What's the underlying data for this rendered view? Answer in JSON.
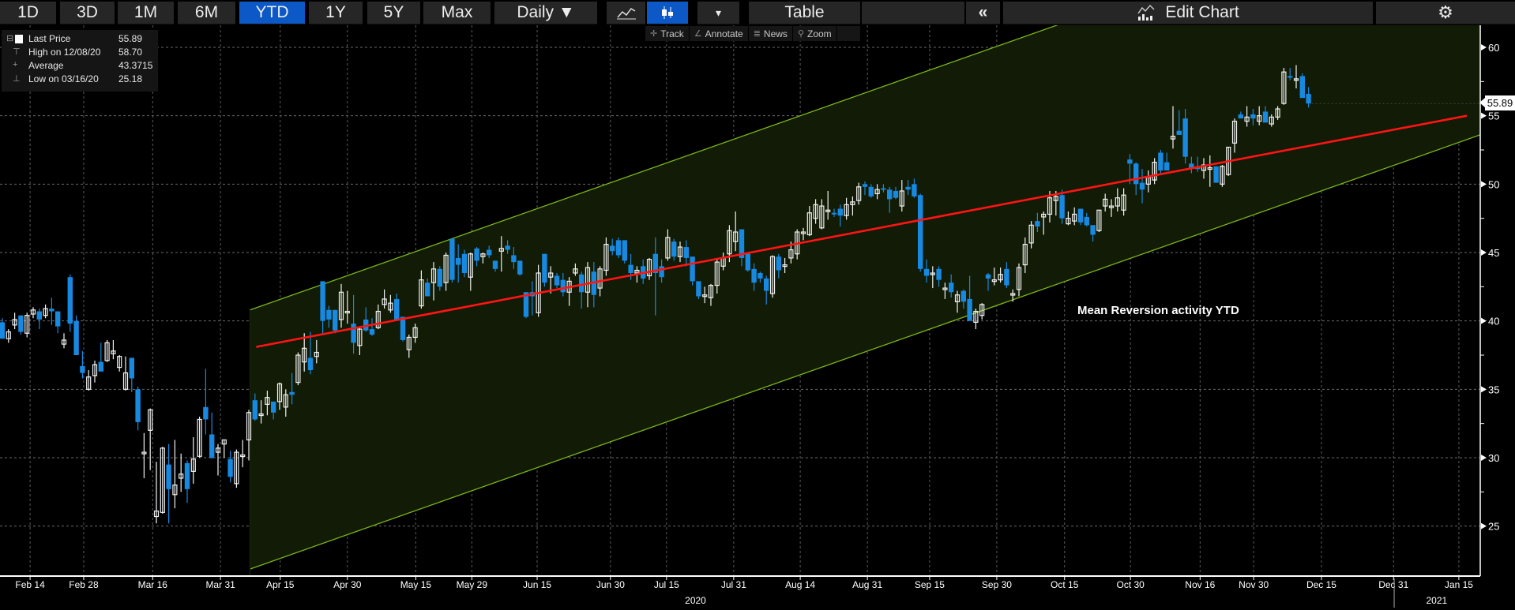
{
  "toolbar": {
    "ranges": [
      "1D",
      "3D",
      "1M",
      "6M",
      "YTD",
      "1Y",
      "5Y",
      "Max"
    ],
    "active_range": "YTD",
    "frequency": "Daily ▼",
    "line_icon": "line-chart-icon",
    "candle_icon": "candlestick-icon",
    "dropdown": "▾",
    "table": "Table",
    "collapse": "«",
    "edit_chart": "Edit Chart",
    "settings_icon": "gear-icon"
  },
  "subbar": {
    "track": "Track",
    "annotate": "Annotate",
    "news": "News",
    "zoom": "Zoom"
  },
  "legend": [
    {
      "label": "Last Price",
      "value": "55.89"
    },
    {
      "label": "High on 12/08/20",
      "value": "58.70"
    },
    {
      "label": "Average",
      "value": "43.3715"
    },
    {
      "label": "Low on 03/16/20",
      "value": "25.18"
    }
  ],
  "annotation": "Mean Reversion activity YTD",
  "last_price_tag": "55.89",
  "colors": {
    "up": "#f2f2f2",
    "down": "#1789e0",
    "regression": "#ff1414",
    "channel_line": "#7cb518",
    "channel_fill": "#121b05",
    "active": "#0b58c6"
  },
  "chart_data": {
    "type": "candlestick",
    "title": "",
    "ylim": [
      22,
      62
    ],
    "yticks": [
      25,
      30,
      35,
      40,
      45,
      50,
      55,
      60
    ],
    "ytick_labels": [
      "25",
      "30",
      "35",
      "40",
      "45",
      "50",
      "55",
      "60"
    ],
    "x_unit": "trading-day index",
    "xticks": [
      {
        "label": "Feb 14",
        "x": 4.5
      },
      {
        "label": "Feb 28",
        "x": 13.2
      },
      {
        "label": "Mar 16",
        "x": 24.4
      },
      {
        "label": "Mar 31",
        "x": 35.4
      },
      {
        "label": "Apr 15",
        "x": 45.1
      },
      {
        "label": "Apr 30",
        "x": 56.0
      },
      {
        "label": "May 15",
        "x": 67.1
      },
      {
        "label": "May 29",
        "x": 76.2
      },
      {
        "label": "Jun 15",
        "x": 86.8
      },
      {
        "label": "Jun 30",
        "x": 98.7
      },
      {
        "label": "Jul 15",
        "x": 107.8
      },
      {
        "label": "Jul 31",
        "x": 118.7
      },
      {
        "label": "Aug 14",
        "x": 129.5
      },
      {
        "label": "Aug 31",
        "x": 140.4
      },
      {
        "label": "Sep 15",
        "x": 150.5
      },
      {
        "label": "Sep 30",
        "x": 161.4
      },
      {
        "label": "Oct 15",
        "x": 172.4
      },
      {
        "label": "Oct 30",
        "x": 183.1
      },
      {
        "label": "Nov 16",
        "x": 194.4
      },
      {
        "label": "Nov 30",
        "x": 203.1
      },
      {
        "label": "Dec 15",
        "x": 214.1
      },
      {
        "label": "Dec 31",
        "x": 225.8
      },
      {
        "label": "Jan 15",
        "x": 236.4
      }
    ],
    "years": [
      {
        "label": "2020",
        "x": 112.5
      },
      {
        "label": "2021",
        "x": 232.8
      }
    ],
    "year_divider_x": 225.9,
    "regression": {
      "x0": 41.2,
      "y0": 38.1,
      "x1": 237.7,
      "y1": 55.0
    },
    "channel": {
      "x0": 40.2,
      "x1": 239.9,
      "upper": [
        40.8,
        72.55
      ],
      "lower": [
        21.86,
        53.61
      ]
    },
    "last_price": 55.89,
    "candles_format": [
      "open",
      "high",
      "low",
      "close"
    ],
    "candles": [
      [
        39.9,
        40.2,
        38.7,
        38.7
      ],
      [
        38.7,
        39.4,
        38.4,
        39.2
      ],
      [
        39.7,
        40.6,
        39.4,
        40.1
      ],
      [
        40.4,
        40.4,
        39.0,
        39.2
      ],
      [
        39.1,
        40.6,
        38.8,
        40.4
      ],
      [
        40.5,
        41.0,
        40.2,
        40.8
      ],
      [
        40.7,
        40.9,
        39.4,
        40.1
      ],
      [
        40.4,
        41.2,
        40.2,
        40.9
      ],
      [
        40.9,
        41.7,
        39.7,
        40.7
      ],
      [
        40.7,
        40.7,
        39.1,
        39.6
      ],
      [
        38.3,
        39.1,
        38.0,
        38.6
      ],
      [
        43.2,
        43.4,
        39.2,
        39.8
      ],
      [
        40.0,
        40.4,
        37.5,
        37.5
      ],
      [
        36.7,
        37.8,
        35.8,
        36.2
      ],
      [
        35.0,
        36.4,
        34.9,
        35.9
      ],
      [
        36.0,
        37.1,
        35.5,
        36.8
      ],
      [
        37.0,
        38.4,
        36.3,
        36.3
      ],
      [
        37.1,
        38.6,
        37.0,
        38.4
      ],
      [
        37.6,
        38.6,
        37.2,
        37.8
      ],
      [
        36.6,
        37.5,
        36.3,
        37.4
      ],
      [
        35.0,
        37.4,
        34.9,
        36.2
      ],
      [
        37.3,
        37.3,
        34.8,
        35.8
      ],
      [
        35.0,
        35.2,
        32.0,
        32.6
      ],
      [
        30.4,
        31.8,
        28.5,
        30.4
      ],
      [
        32.0,
        33.6,
        29.1,
        33.5
      ],
      [
        25.7,
        29.7,
        25.2,
        26.1
      ],
      [
        26.0,
        30.8,
        25.9,
        30.7
      ],
      [
        29.5,
        31.0,
        25.2,
        27.7
      ],
      [
        27.3,
        31.3,
        26.3,
        28.0
      ],
      [
        28.5,
        30.3,
        27.5,
        28.8
      ],
      [
        29.6,
        29.8,
        26.7,
        27.7
      ],
      [
        29.0,
        31.5,
        28.1,
        29.9
      ],
      [
        30.1,
        33.0,
        30.0,
        32.8
      ],
      [
        33.7,
        36.5,
        31.7,
        32.8
      ],
      [
        31.7,
        33.3,
        29.9,
        30.0
      ],
      [
        30.4,
        31.0,
        28.7,
        30.7
      ],
      [
        31.0,
        31.3,
        30.0,
        31.3
      ],
      [
        29.9,
        30.5,
        28.2,
        28.6
      ],
      [
        28.1,
        30.6,
        27.8,
        30.4
      ],
      [
        30.2,
        31.3,
        29.3,
        30.2
      ],
      [
        31.3,
        33.5,
        29.8,
        33.3
      ],
      [
        34.2,
        34.7,
        32.7,
        32.8
      ],
      [
        33.2,
        34.2,
        32.5,
        33.2
      ],
      [
        33.9,
        34.9,
        33.1,
        34.4
      ],
      [
        34.1,
        34.1,
        32.8,
        33.3
      ],
      [
        34.1,
        35.5,
        33.5,
        35.4
      ],
      [
        33.7,
        35.0,
        33.0,
        34.6
      ],
      [
        34.8,
        36.2,
        33.9,
        34.6
      ],
      [
        35.5,
        37.7,
        35.3,
        37.5
      ],
      [
        37.0,
        39.1,
        36.3,
        38.0
      ],
      [
        37.3,
        39.2,
        36.1,
        36.4
      ],
      [
        37.4,
        38.6,
        36.9,
        37.7
      ],
      [
        42.9,
        42.9,
        39.0,
        40.0
      ],
      [
        40.8,
        41.1,
        39.5,
        40.1
      ],
      [
        40.8,
        40.8,
        39.1,
        39.3
      ],
      [
        40.1,
        42.7,
        39.5,
        42.1
      ],
      [
        40.7,
        42.2,
        39.8,
        40.7
      ],
      [
        39.8,
        41.9,
        37.6,
        38.4
      ],
      [
        38.2,
        39.6,
        37.5,
        39.4
      ],
      [
        40.1,
        41.0,
        39.2,
        39.3
      ],
      [
        39.4,
        40.2,
        38.9,
        39.0
      ],
      [
        39.5,
        41.2,
        39.4,
        40.7
      ],
      [
        41.2,
        42.3,
        40.9,
        41.6
      ],
      [
        40.8,
        41.9,
        40.6,
        41.3
      ],
      [
        41.6,
        42.0,
        40.0,
        40.1
      ],
      [
        40.3,
        40.3,
        38.5,
        38.6
      ],
      [
        37.9,
        39.0,
        37.3,
        38.8
      ],
      [
        38.8,
        39.8,
        38.4,
        39.5
      ],
      [
        41.1,
        43.7,
        40.9,
        43.0
      ],
      [
        42.8,
        43.1,
        41.8,
        41.8
      ],
      [
        42.8,
        44.3,
        41.5,
        43.8
      ],
      [
        43.8,
        44.0,
        42.2,
        42.5
      ],
      [
        42.8,
        45.0,
        42.2,
        44.8
      ],
      [
        46.0,
        46.0,
        42.8,
        43.0
      ],
      [
        44.6,
        45.6,
        42.8,
        44.1
      ],
      [
        44.9,
        45.2,
        43.2,
        43.5
      ],
      [
        43.2,
        45.0,
        42.2,
        44.9
      ],
      [
        45.3,
        45.4,
        44.0,
        44.4
      ],
      [
        44.7,
        45.0,
        44.2,
        44.9
      ],
      [
        45.2,
        45.5,
        44.6,
        44.8
      ],
      [
        44.4,
        44.4,
        43.6,
        43.8
      ],
      [
        45.1,
        46.2,
        43.6,
        45.3
      ],
      [
        45.5,
        45.9,
        44.9,
        45.2
      ],
      [
        44.8,
        45.4,
        43.8,
        44.3
      ],
      [
        44.4,
        44.4,
        43.3,
        43.4
      ],
      [
        42.1,
        42.1,
        40.2,
        40.3
      ],
      [
        42.1,
        42.9,
        40.4,
        41.8
      ],
      [
        40.6,
        44.1,
        40.3,
        43.5
      ],
      [
        44.9,
        44.9,
        42.5,
        42.8
      ],
      [
        43.2,
        44.0,
        42.0,
        43.5
      ],
      [
        43.3,
        43.5,
        42.4,
        42.6
      ],
      [
        43.0,
        43.5,
        41.8,
        42.1
      ],
      [
        42.1,
        43.2,
        41.1,
        42.9
      ],
      [
        43.5,
        44.2,
        43.3,
        43.8
      ],
      [
        43.4,
        43.6,
        40.9,
        42.1
      ],
      [
        42.1,
        44.3,
        41.0,
        43.9
      ],
      [
        43.6,
        44.3,
        41.0,
        41.9
      ],
      [
        42.4,
        44.0,
        41.8,
        43.8
      ],
      [
        43.7,
        46.1,
        43.3,
        45.6
      ],
      [
        45.5,
        46.0,
        44.8,
        45.1
      ],
      [
        45.9,
        46.1,
        44.6,
        44.8
      ],
      [
        45.9,
        45.9,
        44.2,
        44.4
      ],
      [
        44.1,
        44.9,
        43.0,
        43.5
      ],
      [
        43.5,
        44.0,
        42.8,
        43.7
      ],
      [
        44.0,
        44.5,
        42.7,
        43.1
      ],
      [
        43.3,
        44.6,
        43.0,
        44.5
      ],
      [
        44.9,
        46.1,
        40.4,
        43.5
      ],
      [
        44.0,
        44.5,
        42.8,
        43.2
      ],
      [
        44.6,
        46.7,
        44.4,
        46.1
      ],
      [
        45.8,
        46.0,
        44.4,
        44.7
      ],
      [
        44.7,
        45.8,
        44.3,
        45.4
      ],
      [
        45.4,
        45.9,
        44.0,
        44.6
      ],
      [
        44.7,
        44.7,
        42.6,
        42.9
      ],
      [
        42.9,
        42.9,
        41.6,
        41.8
      ],
      [
        41.9,
        42.5,
        41.3,
        41.9
      ],
      [
        41.7,
        42.7,
        41.1,
        42.6
      ],
      [
        42.6,
        44.5,
        42.0,
        44.3
      ],
      [
        44.0,
        45.0,
        43.7,
        44.6
      ],
      [
        44.9,
        47.0,
        44.3,
        46.6
      ],
      [
        45.8,
        48.0,
        45.1,
        46.5
      ],
      [
        46.7,
        46.7,
        44.0,
        44.6
      ],
      [
        44.9,
        45.0,
        43.6,
        43.7
      ],
      [
        43.8,
        44.2,
        42.2,
        42.8
      ],
      [
        43.5,
        43.6,
        42.8,
        43.1
      ],
      [
        43.1,
        43.3,
        41.2,
        42.2
      ],
      [
        42.0,
        44.8,
        41.7,
        44.7
      ],
      [
        44.7,
        44.9,
        43.1,
        43.7
      ],
      [
        44.1,
        44.6,
        43.5,
        44.1
      ],
      [
        44.6,
        45.8,
        44.2,
        45.2
      ],
      [
        44.9,
        46.7,
        44.5,
        46.5
      ],
      [
        46.4,
        46.8,
        45.9,
        46.5
      ],
      [
        46.3,
        48.4,
        46.2,
        47.9
      ],
      [
        47.5,
        48.9,
        47.1,
        48.5
      ],
      [
        46.8,
        48.9,
        46.7,
        48.4
      ],
      [
        48.1,
        49.5,
        47.4,
        48.1
      ],
      [
        47.9,
        48.2,
        47.6,
        47.8
      ],
      [
        48.2,
        48.5,
        46.9,
        47.7
      ],
      [
        47.7,
        49.0,
        47.4,
        48.5
      ],
      [
        48.5,
        49.1,
        47.7,
        48.7
      ],
      [
        48.8,
        50.1,
        48.5,
        49.8
      ],
      [
        50.0,
        50.2,
        49.2,
        49.8
      ],
      [
        49.8,
        50.0,
        49.0,
        49.1
      ],
      [
        49.3,
        50.0,
        48.9,
        49.6
      ],
      [
        49.7,
        50.0,
        49.4,
        49.6
      ],
      [
        49.6,
        49.8,
        47.9,
        48.9
      ],
      [
        49.5,
        49.8,
        48.9,
        49.0
      ],
      [
        48.4,
        50.3,
        48.0,
        49.5
      ],
      [
        49.8,
        50.3,
        49.2,
        49.6
      ],
      [
        50.0,
        50.4,
        49.0,
        49.1
      ],
      [
        49.2,
        49.3,
        43.6,
        43.8
      ],
      [
        43.8,
        44.5,
        42.8,
        43.3
      ],
      [
        43.5,
        44.0,
        42.4,
        43.5
      ],
      [
        43.8,
        44.0,
        42.5,
        43.0
      ],
      [
        42.4,
        42.8,
        41.6,
        42.4
      ],
      [
        42.8,
        43.4,
        41.7,
        42.1
      ],
      [
        41.4,
        42.2,
        40.6,
        41.9
      ],
      [
        42.2,
        42.3,
        40.9,
        41.4
      ],
      [
        41.6,
        43.3,
        40.0,
        40.0
      ],
      [
        39.9,
        40.9,
        39.4,
        40.7
      ],
      [
        40.4,
        41.3,
        40.1,
        41.2
      ],
      [
        43.4,
        43.5,
        42.2,
        43.1
      ],
      [
        43.0,
        43.9,
        42.6,
        43.0
      ],
      [
        43.0,
        43.9,
        42.8,
        43.4
      ],
      [
        43.8,
        44.3,
        42.4,
        42.6
      ],
      [
        41.9,
        42.3,
        41.4,
        42.0
      ],
      [
        42.3,
        44.2,
        41.8,
        43.9
      ],
      [
        44.1,
        46.1,
        43.5,
        45.6
      ],
      [
        45.7,
        47.3,
        45.3,
        47.0
      ],
      [
        47.3,
        47.9,
        46.5,
        46.9
      ],
      [
        47.6,
        48.0,
        46.3,
        47.8
      ],
      [
        47.8,
        49.5,
        47.2,
        49.0
      ],
      [
        48.8,
        49.5,
        47.7,
        49.1
      ],
      [
        49.2,
        49.6,
        47.1,
        47.5
      ],
      [
        47.1,
        48.0,
        47.0,
        47.5
      ],
      [
        47.3,
        48.3,
        47.0,
        47.8
      ],
      [
        48.2,
        48.2,
        47.0,
        47.2
      ],
      [
        47.6,
        47.9,
        46.9,
        47.0
      ],
      [
        47.0,
        47.0,
        45.8,
        46.3
      ],
      [
        46.6,
        48.1,
        46.5,
        48.1
      ],
      [
        48.4,
        49.3,
        48.0,
        48.9
      ],
      [
        48.4,
        48.9,
        47.6,
        48.4
      ],
      [
        48.4,
        49.7,
        48.0,
        49.0
      ],
      [
        48.1,
        49.7,
        47.7,
        49.2
      ],
      [
        51.8,
        52.2,
        50.0,
        51.5
      ],
      [
        51.5,
        51.6,
        49.2,
        50.0
      ],
      [
        50.1,
        51.1,
        48.6,
        49.6
      ],
      [
        50.0,
        51.0,
        49.4,
        50.5
      ],
      [
        50.3,
        51.9,
        50.0,
        51.6
      ],
      [
        52.3,
        52.5,
        50.7,
        51.0
      ],
      [
        51.6,
        52.3,
        51.0,
        51.0
      ],
      [
        53.3,
        55.7,
        52.6,
        53.5
      ],
      [
        53.9,
        55.4,
        53.6,
        53.6
      ],
      [
        54.8,
        55.5,
        51.5,
        52.0
      ],
      [
        51.5,
        52.0,
        50.8,
        51.2
      ],
      [
        51.3,
        52.0,
        50.9,
        51.1
      ],
      [
        51.0,
        51.9,
        50.4,
        51.4
      ],
      [
        51.2,
        52.1,
        49.8,
        51.2
      ],
      [
        51.3,
        51.3,
        50.1,
        50.1
      ],
      [
        50.0,
        51.4,
        49.8,
        51.3
      ],
      [
        50.7,
        52.7,
        50.6,
        52.7
      ],
      [
        53.0,
        54.8,
        52.3,
        54.6
      ],
      [
        55.1,
        55.3,
        54.8,
        54.8
      ],
      [
        54.6,
        55.7,
        54.2,
        54.9
      ],
      [
        55.1,
        55.5,
        54.3,
        54.8
      ],
      [
        54.6,
        55.7,
        54.3,
        55.0
      ],
      [
        55.3,
        55.7,
        54.5,
        54.5
      ],
      [
        54.4,
        55.1,
        54.2,
        54.9
      ],
      [
        54.9,
        55.7,
        54.7,
        55.5
      ],
      [
        55.9,
        58.5,
        55.8,
        58.2
      ],
      [
        57.9,
        58.5,
        57.6,
        57.8
      ],
      [
        57.7,
        58.7,
        57.0,
        57.7
      ],
      [
        57.9,
        58.1,
        56.3,
        56.3
      ],
      [
        56.6,
        57.1,
        55.6,
        55.89
      ]
    ]
  }
}
